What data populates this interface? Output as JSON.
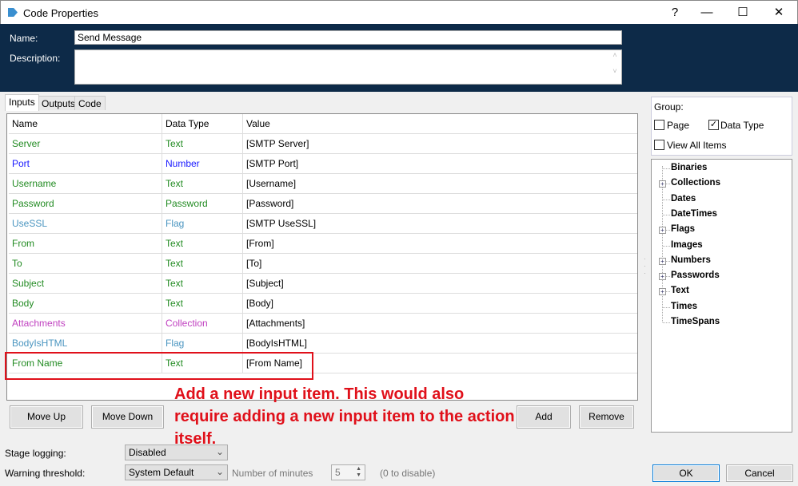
{
  "window": {
    "title": "Code Properties",
    "help": "?",
    "minimize": "—",
    "maximize": "☐",
    "close": "✕"
  },
  "header": {
    "name_label": "Name:",
    "name_value": "Send Message",
    "description_label": "Description:",
    "description_value": ""
  },
  "tabs": [
    "Inputs",
    "Outputs",
    "Code"
  ],
  "table": {
    "columns": [
      "Name",
      "Data Type",
      "Value"
    ],
    "rows": [
      {
        "name": "Server",
        "type": "Text",
        "value": "[SMTP Server]",
        "color": "#228b22"
      },
      {
        "name": "Port",
        "type": "Number",
        "value": "[SMTP Port]",
        "color": "#1a1aff"
      },
      {
        "name": "Username",
        "type": "Text",
        "value": "[Username]",
        "color": "#228b22"
      },
      {
        "name": "Password",
        "type": "Password",
        "value": "[Password]",
        "color": "#228b22"
      },
      {
        "name": "UseSSL",
        "type": "Flag",
        "value": "[SMTP UseSSL]",
        "color": "#4a95c0"
      },
      {
        "name": "From",
        "type": "Text",
        "value": "[From]",
        "color": "#228b22"
      },
      {
        "name": "To",
        "type": "Text",
        "value": "[To]",
        "color": "#228b22"
      },
      {
        "name": "Subject",
        "type": "Text",
        "value": "[Subject]",
        "color": "#228b22"
      },
      {
        "name": "Body",
        "type": "Text",
        "value": "[Body]",
        "color": "#228b22"
      },
      {
        "name": "Attachments",
        "type": "Collection",
        "value": "[Attachments]",
        "color": "#c040c0"
      },
      {
        "name": "BodyIsHTML",
        "type": "Flag",
        "value": "[BodyIsHTML]",
        "color": "#4a95c0"
      },
      {
        "name": "From Name",
        "type": "Text",
        "value": "[From Name]",
        "color": "#228b22"
      }
    ]
  },
  "buttons": {
    "move_up": "Move Up",
    "move_down": "Move Down",
    "add": "Add",
    "remove": "Remove",
    "ok": "OK",
    "cancel": "Cancel"
  },
  "group": {
    "label": "Group:",
    "page": "Page",
    "page_checked": false,
    "data_type": "Data Type",
    "data_type_checked": true,
    "view_all": "View All Items",
    "view_all_checked": false
  },
  "tree": [
    {
      "label": "Binaries",
      "expandable": false
    },
    {
      "label": "Collections",
      "expandable": true
    },
    {
      "label": "Dates",
      "expandable": false
    },
    {
      "label": "DateTimes",
      "expandable": false
    },
    {
      "label": "Flags",
      "expandable": true
    },
    {
      "label": "Images",
      "expandable": false
    },
    {
      "label": "Numbers",
      "expandable": true
    },
    {
      "label": "Passwords",
      "expandable": true
    },
    {
      "label": "Text",
      "expandable": true
    },
    {
      "label": "Times",
      "expandable": false
    },
    {
      "label": "TimeSpans",
      "expandable": false
    }
  ],
  "footer": {
    "stage_logging_label": "Stage logging:",
    "stage_logging_value": "Disabled",
    "warning_label": "Warning threshold:",
    "warning_value": "System Default",
    "minutes_label": "Number of minutes",
    "minutes_value": "5",
    "disable_hint": "(0 to disable)"
  },
  "annotation": "Add a new input item. This would also require adding a new input item to the action itself."
}
